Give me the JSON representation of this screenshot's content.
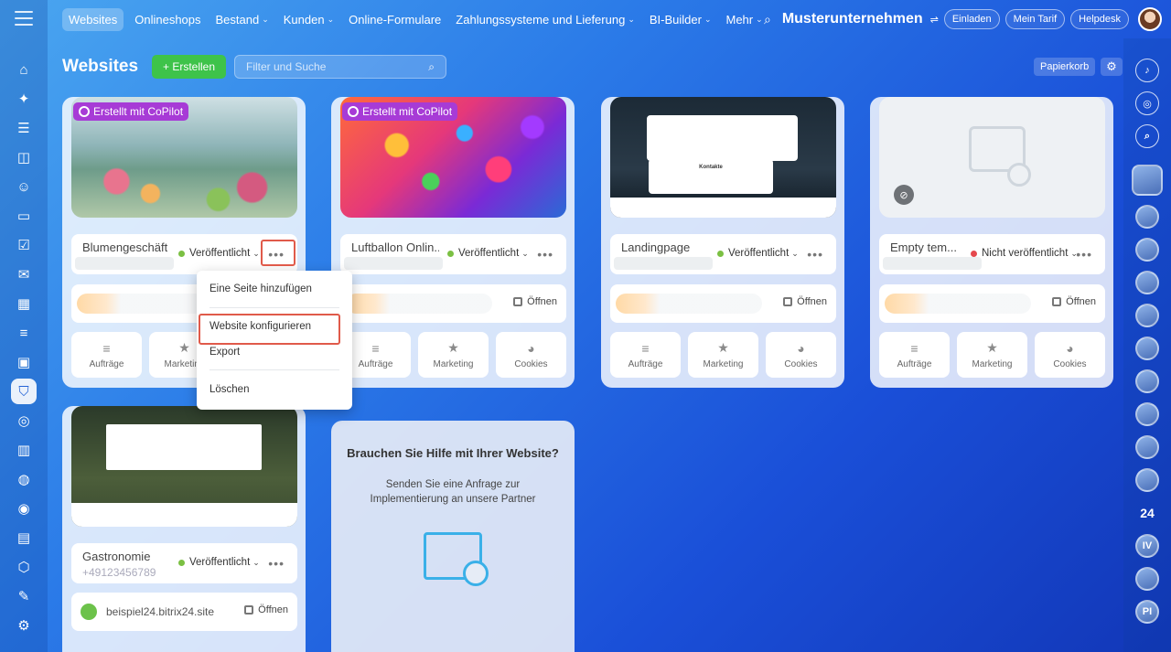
{
  "topnav": {
    "tabs": [
      {
        "label": "Websites"
      },
      {
        "label": "Onlineshops"
      },
      {
        "label": "Bestand"
      },
      {
        "label": "Kunden"
      },
      {
        "label": "Online-Formulare"
      },
      {
        "label": "Zahlungssysteme und Lieferung"
      },
      {
        "label": "BI-Builder"
      },
      {
        "label": "Mehr"
      }
    ],
    "company": "Musterunternehmen",
    "invite": "Einladen",
    "tariff": "Mein Tarif",
    "helpdesk": "Helpdesk"
  },
  "page": {
    "title": "Websites",
    "create_button": "+ Erstellen",
    "search_placeholder": "Filter und Suche",
    "trash_button": "Papierkorb"
  },
  "badge": "Erstellt mit CoPilot",
  "cards": [
    {
      "name": "Blumengeschäft",
      "status": "Veröffentlicht",
      "status_color": "#7bc043"
    },
    {
      "name": "Luftballon Onlin...",
      "status": "Veröffentlicht",
      "status_color": "#7bc043"
    },
    {
      "name": "Landingpage",
      "status": "Veröffentlicht",
      "status_color": "#7bc043"
    },
    {
      "name": "Empty tem...",
      "status": "Nicht veröffentlicht",
      "status_color": "#e5484d"
    },
    {
      "name": "Gastronomie",
      "phone": "+49123456789",
      "status": "Veröffentlicht",
      "status_color": "#7bc043",
      "domain": "beispiel24.bitrix24.site"
    }
  ],
  "actions": {
    "orders": "Aufträge",
    "marketing": "Marketing",
    "cookies": "Cookies",
    "open": "Öffnen"
  },
  "dropdown": {
    "items": [
      "Eine Seite hinzufügen",
      "Website konfigurieren",
      "Export",
      "Löschen"
    ]
  },
  "help": {
    "title": "Brauchen Sie Hilfe mit Ihrer Website?",
    "text": "Senden Sie eine Anfrage zur Implementierung an unsere Partner"
  },
  "landing_thumb": {
    "contacts": "Kontakte"
  },
  "right_bar": {
    "b24": "24",
    "iv": "IV",
    "pi": "PI"
  }
}
